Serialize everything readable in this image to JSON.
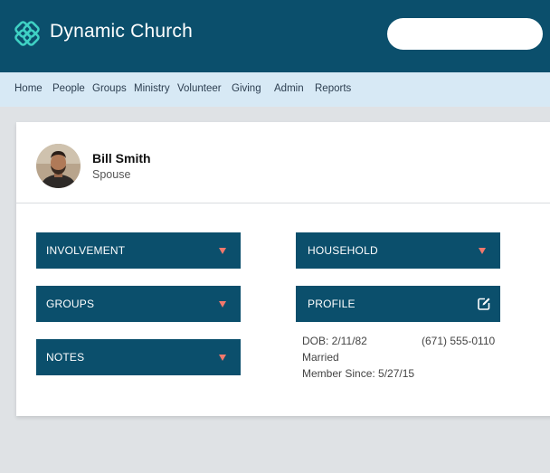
{
  "header": {
    "app_title": "Dynamic Church",
    "search_placeholder": "",
    "brand_color": "#0b4f6c",
    "logo_icon": "interlocking-diamonds-logo"
  },
  "nav": {
    "items": [
      {
        "label": "Home"
      },
      {
        "label": "People"
      },
      {
        "label": "Groups"
      },
      {
        "label": "Ministry"
      },
      {
        "label": "Volunteer"
      },
      {
        "label": "Giving"
      },
      {
        "label": "Admin"
      },
      {
        "label": "Reports"
      }
    ]
  },
  "person": {
    "name": "Bill Smith",
    "role": "Spouse"
  },
  "panels": {
    "involvement": "INVOLVEMENT",
    "groups": "GROUPS",
    "notes": "NOTES",
    "household": "HOUSEHOLD",
    "profile": "PROFILE",
    "accent_color": "#f2786c"
  },
  "profile": {
    "dob": "DOB:  2/11/82",
    "phone": "(671) 555-0110",
    "marital_status": "Married",
    "member_since": "Member Since: 5/27/15"
  }
}
